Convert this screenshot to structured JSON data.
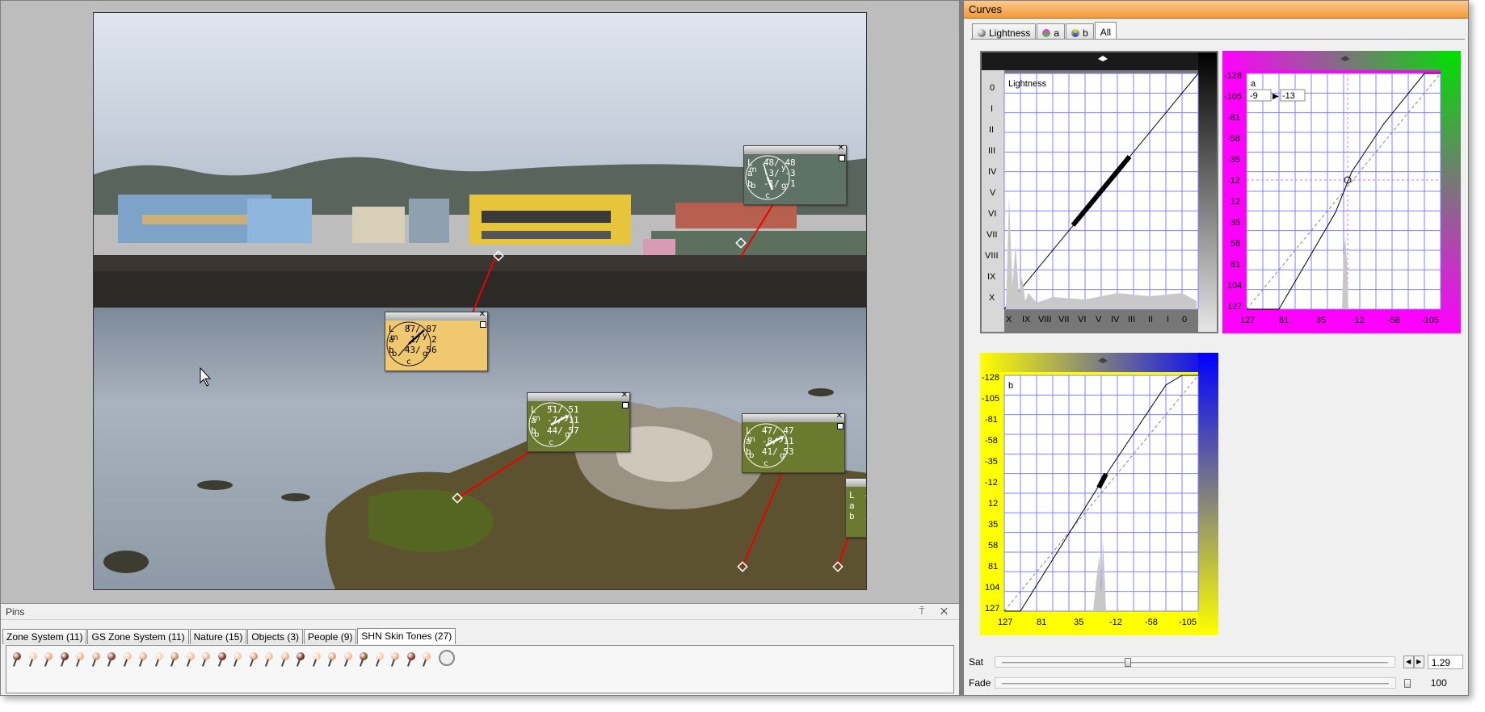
{
  "curves": {
    "title": "Curves",
    "tabs": [
      {
        "label": "Lightness",
        "icon": "lightness-icon",
        "active": false
      },
      {
        "label": "a",
        "icon": "a-channel-icon",
        "active": false
      },
      {
        "label": "b",
        "icon": "b-channel-icon",
        "active": false
      },
      {
        "label": "All",
        "icon": "",
        "active": true
      }
    ],
    "lightness": {
      "label": "Lightness",
      "y_ticks": [
        "0",
        "I",
        "II",
        "III",
        "IV",
        "V",
        "VI",
        "VII",
        "VIII",
        "IX",
        "X"
      ],
      "x_ticks": [
        "X",
        "IX",
        "VIII",
        "VII",
        "VI",
        "V",
        "IV",
        "III",
        "II",
        "I",
        "0"
      ]
    },
    "a": {
      "label": "a",
      "input_value": "-9",
      "output_value": "-13",
      "y_ticks": [
        "-128",
        "-105",
        "-81",
        "-58",
        "-35",
        "-12",
        "12",
        "35",
        "58",
        "81",
        "104",
        "127"
      ],
      "x_ticks": [
        "127",
        "81",
        "35",
        "-12",
        "-58",
        "-105"
      ]
    },
    "b": {
      "label": "b",
      "y_ticks": [
        "-128",
        "-105",
        "-81",
        "-58",
        "-35",
        "-12",
        "12",
        "35",
        "58",
        "81",
        "104",
        "127"
      ],
      "x_ticks": [
        "127",
        "81",
        "35",
        "-12",
        "-58",
        "-105"
      ]
    },
    "sat": {
      "label": "Sat",
      "value": "1.29",
      "position": 0.32
    },
    "fade": {
      "label": "Fade",
      "value": "100",
      "position": 1.0
    }
  },
  "pins_panel": {
    "title": "Pins",
    "controls": "⍑ ✕",
    "tabs": [
      {
        "label": "Zone System (11)",
        "active": false
      },
      {
        "label": "GS Zone System (11)",
        "active": false
      },
      {
        "label": "Nature (15)",
        "active": false
      },
      {
        "label": "Objects (3)",
        "active": false
      },
      {
        "label": "People (9)",
        "active": false
      },
      {
        "label": "SHN Skin Tones (27)",
        "active": true
      }
    ],
    "pin_colors": [
      "#7a3d22",
      "#f2c9a8",
      "#e8a98a",
      "#6b2f1e",
      "#f0b48c",
      "#d99c76",
      "#7f3a24",
      "#f3c4a2",
      "#e2a785",
      "#f6d0b2",
      "#c98a66",
      "#f2bb96",
      "#e6b08f",
      "#7d2d1c",
      "#f5c7a6",
      "#d89672",
      "#f0c09f",
      "#e9ad88",
      "#6a2a19",
      "#f7cfb1",
      "#dea07d",
      "#f0b896",
      "#8b4429",
      "#f4c8a8",
      "#e3a884",
      "#802e1f",
      "#f5be96"
    ]
  },
  "color_readouts": [
    {
      "L": "L  48/ 48",
      "a": "a  -3/ -3",
      "b": "b  -1/ -1",
      "color": "#5e7266",
      "angle": 200
    },
    {
      "L": "L  87/ 87",
      "a": "a   1/  2",
      "b": "b  43/ 56",
      "color": "#f0c870",
      "angle": 50
    },
    {
      "L": "L  51/ 51",
      "a": "a  -7/-11",
      "b": "b  44/ 57",
      "color": "#6b7a2e",
      "angle": 60
    },
    {
      "L": "L  47/ 47",
      "a": "a  -8/-11",
      "b": "b  41/ 53",
      "color": "#6b7a2e",
      "angle": 60
    },
    {
      "L": "L  44/ 44",
      "a": "a  -8/-11",
      "b": "b  36/ 47",
      "color": "#6b7a2e",
      "angle": 60
    }
  ],
  "dial_letters": [
    "r",
    "y",
    "g",
    "c",
    "b",
    "m"
  ]
}
